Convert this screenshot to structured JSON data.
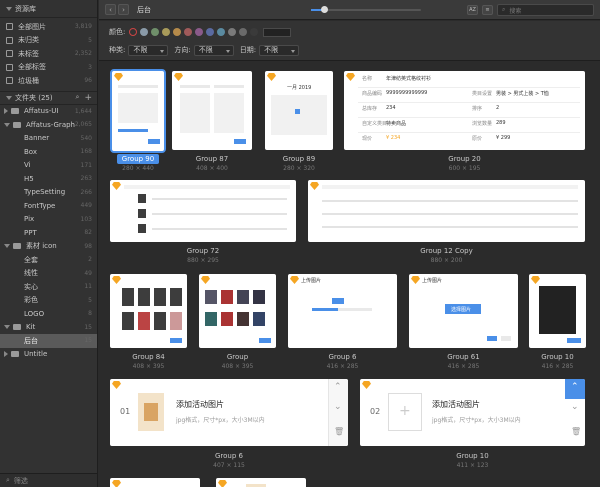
{
  "sidebar": {
    "title": "资源库",
    "library": [
      {
        "label": "全部图片",
        "count": "3,819"
      },
      {
        "label": "未归类",
        "count": "5"
      },
      {
        "label": "未标签",
        "count": "2,352"
      },
      {
        "label": "全部标签",
        "count": "3"
      },
      {
        "label": "垃圾桶",
        "count": "96"
      }
    ],
    "files_header": "文件夹 (25)",
    "folders": [
      {
        "label": "Affatus-UI",
        "count": "1,644",
        "depth": 0,
        "expanded": false
      },
      {
        "label": "Affatus-Graphics",
        "count": "2,065",
        "depth": 0,
        "expanded": true
      },
      {
        "label": "Banner",
        "count": "540",
        "depth": 1
      },
      {
        "label": "Box",
        "count": "168",
        "depth": 1
      },
      {
        "label": "Vi",
        "count": "171",
        "depth": 1
      },
      {
        "label": "H5",
        "count": "263",
        "depth": 1
      },
      {
        "label": "TypeSetting",
        "count": "266",
        "depth": 1
      },
      {
        "label": "FontType",
        "count": "449",
        "depth": 1
      },
      {
        "label": "Pix",
        "count": "103",
        "depth": 1
      },
      {
        "label": "PPT",
        "count": "82",
        "depth": 1
      },
      {
        "label": "素材 icon",
        "count": "98",
        "depth": 0,
        "expanded": true
      },
      {
        "label": "全套",
        "count": "2",
        "depth": 1
      },
      {
        "label": "线性",
        "count": "49",
        "depth": 1
      },
      {
        "label": "实心",
        "count": "11",
        "depth": 1
      },
      {
        "label": "彩色",
        "count": "5",
        "depth": 1
      },
      {
        "label": "LOGO",
        "count": "8",
        "depth": 1
      },
      {
        "label": "Kit",
        "count": "15",
        "depth": 0,
        "expanded": true
      },
      {
        "label": "后台",
        "count": "15",
        "depth": 1,
        "active": true
      },
      {
        "label": "Untitle",
        "count": "",
        "depth": 0
      }
    ],
    "filter_placeholder": "筛选"
  },
  "toolbar": {
    "back": "‹",
    "forward": "›",
    "title": "后台",
    "zoom_level": 0.12,
    "sort_label": "AZ",
    "search_placeholder": "搜索"
  },
  "filters": {
    "color_label": "颜色:",
    "colors": [
      "#8a9aa8",
      "#6f8f6a",
      "#a89a5a",
      "#b58a4a",
      "#a05a5a",
      "#8a5a8a",
      "#5a6aa0",
      "#5a8aa0",
      "#7a7a7a",
      "#6a6a6a",
      "#3a3a3a"
    ],
    "type_label": "种类:",
    "type_value": "不限",
    "direction_label": "方向:",
    "direction_value": "不限",
    "date_label": "日期:",
    "date_value": "不限"
  },
  "cards": [
    {
      "name": "Group 90",
      "size": "280 × 440",
      "selected": true
    },
    {
      "name": "Group 87",
      "size": "408 × 400"
    },
    {
      "name": "Group 89",
      "size": "280 × 320"
    },
    {
      "name": "Group 20",
      "size": "600 × 195"
    },
    {
      "name": "Group 72",
      "size": "880 × 295"
    },
    {
      "name": "Group 12 Copy",
      "size": "880 × 200"
    },
    {
      "name": "Group 84",
      "size": "408 × 395"
    },
    {
      "name": "Group",
      "size": "408 × 395"
    },
    {
      "name": "Group 6",
      "size": "416 × 285"
    },
    {
      "name": "Group 61",
      "size": "416 × 285"
    },
    {
      "name": "Group 10",
      "size": "416 × 285"
    },
    {
      "name": "Group 6",
      "size": "407 × 115"
    },
    {
      "name": "Group 10",
      "size": "411 × 123"
    }
  ],
  "group20": {
    "rows": [
      [
        "名称",
        "年津纺英式格纹衬衫",
        "",
        ""
      ],
      [
        "商品编码",
        "9999999999999",
        "类目设置",
        "男装 > 男式上装 > T恤"
      ],
      [
        "总库存",
        "234",
        "排序",
        "2"
      ],
      [
        "自定义类目",
        "特卖商品",
        "浏览数量",
        "289"
      ],
      [
        "现价",
        "¥ 234",
        "原价",
        "¥ 299"
      ]
    ]
  },
  "group6": {
    "index": "01",
    "title": "添加活动图片",
    "sub": "jpg格式，尺寸*px，大小3M以内"
  },
  "group10": {
    "index": "02",
    "title": "添加活动图片",
    "sub": "jpg格式，尺寸*px，大小3M以内"
  },
  "group61": {
    "button": "选择图片",
    "title": "上传图片"
  },
  "group6b": {
    "title": "上传图片"
  },
  "calendar_header": "一月 2019"
}
